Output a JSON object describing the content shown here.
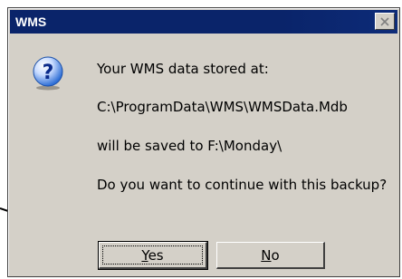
{
  "window": {
    "title": "WMS"
  },
  "icons": {
    "question": "question-icon",
    "close": "close-icon",
    "arrow": "arrow-icon"
  },
  "message": {
    "line1": "Your WMS data stored at:",
    "line2": "C:\\ProgramData\\WMS\\WMSData.Mdb",
    "line3": "will be saved to F:\\Monday\\",
    "line4": "Do you want to continue with this backup?"
  },
  "buttons": {
    "yes": {
      "pre": "",
      "accel": "Y",
      "post": "es"
    },
    "no": {
      "pre": "",
      "accel": "N",
      "post": "o"
    }
  },
  "colors": {
    "titlebar": "#0a246a",
    "dialog_bg": "#d4d0c8",
    "question_icon": "#2f6fd6"
  }
}
